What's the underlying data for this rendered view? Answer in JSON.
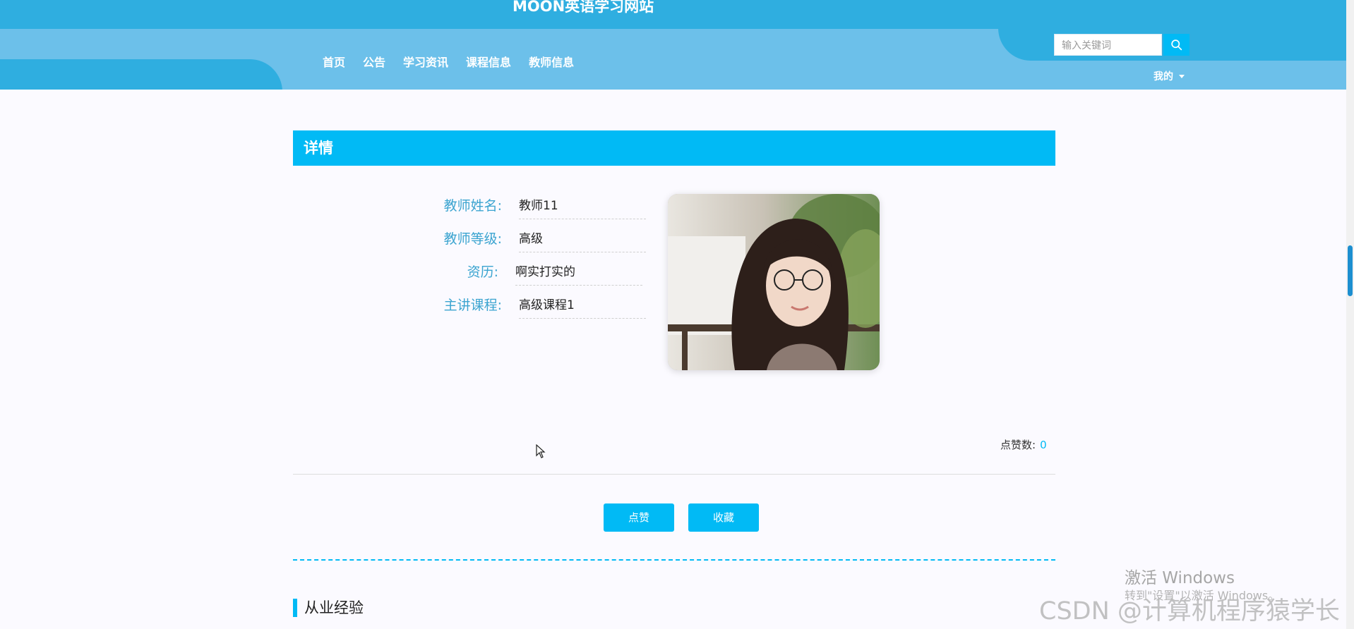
{
  "header": {
    "site_title": "MOON英语学习网站",
    "nav_items": [
      "首页",
      "公告",
      "学习资讯",
      "课程信息",
      "教师信息"
    ],
    "search_placeholder": "输入关键词",
    "user_menu_label": "我的",
    "colors": {
      "header_dark": "#2faee0",
      "header_light": "#6cc0ea",
      "accent": "#01baf5"
    }
  },
  "detail": {
    "title": "详情",
    "fields": [
      {
        "label": "教师姓名:",
        "value": "教师11"
      },
      {
        "label": "教师等级:",
        "value": "高级"
      },
      {
        "label": "资历:",
        "value": "啊实打实的"
      },
      {
        "label": "主讲课程:",
        "value": "高级课程1"
      }
    ],
    "photo_icon": "teacher-photo",
    "likes_label": "点赞数:",
    "likes_count": "0",
    "like_button": "点赞",
    "favorite_button": "收藏"
  },
  "section": {
    "title": "从业经验"
  },
  "watermarks": {
    "windows_activate": "激活 Windows",
    "windows_activate_sub": "转到\"设置\"以激活 Windows。",
    "csdn": "CSDN @计算机程序猿学长"
  }
}
